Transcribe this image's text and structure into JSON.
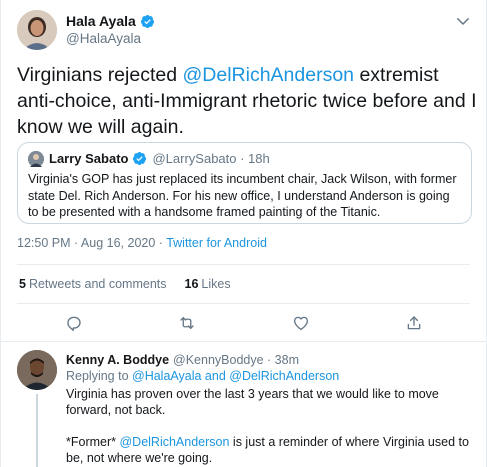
{
  "main_tweet": {
    "author_name": "Hala Ayala",
    "author_handle": "@HalaAyala",
    "text_before": "Virginians rejected ",
    "mention": "@DelRichAnderson",
    "text_after": " extremist anti-choice, anti-Immigrant rhetoric twice before and I know we will again.",
    "timestamp": "12:50 PM · Aug 16, 2020 · ",
    "source": "Twitter for Android",
    "retweets_count": "5",
    "retweets_label": "Retweets and comments",
    "likes_count": "16",
    "likes_label": "Likes"
  },
  "quoted_tweet": {
    "author_name": "Larry Sabato",
    "author_handle": "@LarrySabato · 18h",
    "text": "Virginia's GOP has just replaced its incumbent chair, Jack Wilson, with former state Del. Rich Anderson. For his new office, I understand Anderson is going to be presented with a handsome framed painting of the Titanic."
  },
  "reply": {
    "author_name": "Kenny A. Boddye",
    "author_handle": "@KennyBoddye · 38m",
    "replying_prefix": "Replying to ",
    "replying_to": "@HalaAyala and @DelRichAnderson",
    "paragraph1": "Virginia has proven over the last 3 years that we would like to move forward, not back.",
    "p2_before": "*Former* ",
    "p2_mention": "@DelRichAnderson",
    "p2_after": " is just a reminder of where Virginia used to be, not where we're going."
  },
  "icons": {
    "verified": "verified-badge-icon",
    "caret": "chevron-down-icon",
    "reply": "comment-icon",
    "retweet": "retweet-icon",
    "like": "heart-icon",
    "share": "share-icon"
  },
  "colors": {
    "link": "#1b95e0",
    "secondary_text": "#657786",
    "border": "#e6ecf0"
  }
}
